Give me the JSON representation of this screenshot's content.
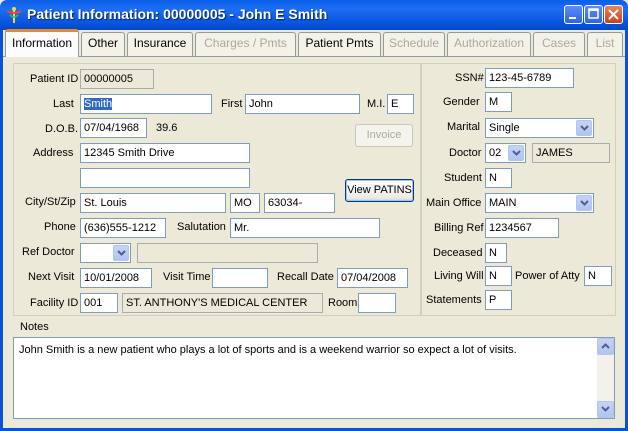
{
  "window": {
    "title": "Patient Information: 00000005 - John E Smith",
    "icon": "caduceus-icon"
  },
  "tabs": [
    {
      "label": "Information",
      "active": true,
      "enabled": true
    },
    {
      "label": "Other",
      "enabled": true
    },
    {
      "label": "Insurance",
      "enabled": true
    },
    {
      "label": "Charges / Pmts",
      "enabled": false
    },
    {
      "label": "Patient Pmts",
      "enabled": true
    },
    {
      "label": "Schedule",
      "enabled": false
    },
    {
      "label": "Authorization",
      "enabled": false
    },
    {
      "label": "Cases",
      "enabled": false
    },
    {
      "label": "List",
      "enabled": false
    }
  ],
  "left": {
    "patient_id": {
      "label": "Patient ID",
      "value": "00000005"
    },
    "last": {
      "label": "Last",
      "value": "Smith"
    },
    "first": {
      "label": "First",
      "value": "John"
    },
    "mi": {
      "label": "M.I.",
      "value": "E"
    },
    "dob": {
      "label": "D.O.B.",
      "value": "07/04/1968",
      "age": "39.6"
    },
    "invoice_button": "Invoice",
    "address": {
      "label": "Address",
      "line1": "12345 Smith Drive",
      "line2": ""
    },
    "city_st_zip": {
      "label": "City/St/Zip",
      "city": "St. Louis",
      "state": "MO",
      "zip": "63034-"
    },
    "view_patins_button": "View PATINS",
    "phone": {
      "label": "Phone",
      "value": "(636)555-1212"
    },
    "salutation": {
      "label": "Salutation",
      "value": "Mr."
    },
    "ref_doctor": {
      "label": "Ref Doctor",
      "value": "",
      "name": ""
    },
    "next_visit": {
      "label": "Next Visit",
      "value": "10/01/2008"
    },
    "visit_time": {
      "label": "Visit Time",
      "value": ""
    },
    "recall_date": {
      "label": "Recall Date",
      "value": "07/04/2008"
    },
    "facility_id": {
      "label": "Facility ID",
      "value": "001",
      "name": "ST. ANTHONY'S MEDICAL CENTER"
    },
    "room": {
      "label": "Room",
      "value": ""
    }
  },
  "right": {
    "ssn": {
      "label": "SSN#",
      "value": "123-45-6789"
    },
    "gender": {
      "label": "Gender",
      "value": "M"
    },
    "marital": {
      "label": "Marital",
      "value": "Single"
    },
    "doctor": {
      "label": "Doctor",
      "value": "02",
      "name": "JAMES"
    },
    "student": {
      "label": "Student",
      "value": "N"
    },
    "main_office": {
      "label": "Main Office",
      "value": "MAIN"
    },
    "billing_ref": {
      "label": "Billing Ref",
      "value": "1234567"
    },
    "deceased": {
      "label": "Deceased",
      "value": "N"
    },
    "living_will": {
      "label": "Living Will",
      "value": "N"
    },
    "power_of_atty": {
      "label": "Power of Atty",
      "value": "N"
    },
    "statements": {
      "label": "Statements",
      "value": "P"
    }
  },
  "notes": {
    "label": "Notes",
    "text": "John Smith is a new patient who plays a lot of sports and is a weekend warrior so expect a lot of visits."
  },
  "colors": {
    "titlebar": "#0A5FE8",
    "active_tab_accent": "#E68B2C",
    "selection": "#316AC5"
  }
}
